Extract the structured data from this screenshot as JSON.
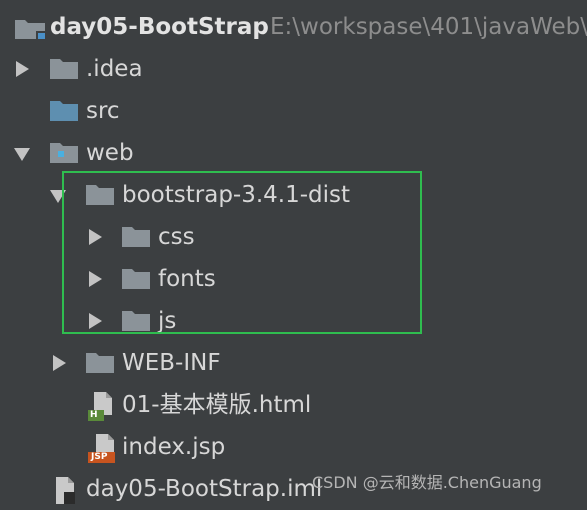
{
  "project": {
    "name": "day05-BootStrap",
    "path": "E:\\workspase\\401\\javaWeb\\"
  },
  "tree": {
    "idea": ".idea",
    "src": "src",
    "web": "web",
    "bootstrap": "bootstrap-3.4.1-dist",
    "css": "css",
    "fonts": "fonts",
    "js": "js",
    "webinf": "WEB-INF",
    "html_file": "01-基本模版.html",
    "jsp_file": "index.jsp",
    "iml_file": "day05-BootStrap.iml"
  },
  "badges": {
    "html": "H",
    "jsp": "JSP"
  },
  "colors": {
    "background": "#3c3f41",
    "folder": "#8b9399",
    "src_folder": "#5e8fb0",
    "highlight_box": "#2fbd4f",
    "html_badge": "#5a8a3a",
    "jsp_badge": "#c7541f"
  },
  "watermark": "CSDN @云和数据.ChenGuang"
}
